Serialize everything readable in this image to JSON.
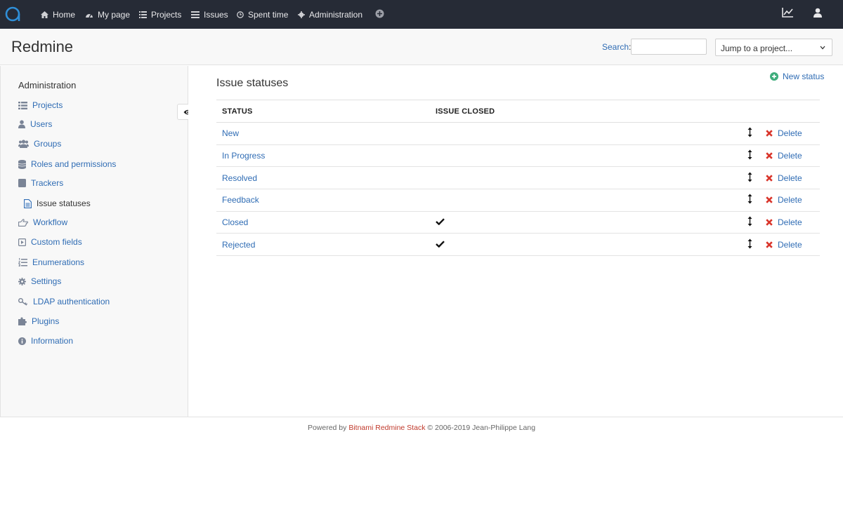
{
  "topnav": {
    "items": [
      {
        "label": "Home",
        "icon": "home-icon"
      },
      {
        "label": "My page",
        "icon": "dashboard-icon"
      },
      {
        "label": "Projects",
        "icon": "list-icon"
      },
      {
        "label": "Issues",
        "icon": "issues-icon"
      },
      {
        "label": "Spent time",
        "icon": "clock-icon"
      },
      {
        "label": "Administration",
        "icon": "gear-icon"
      }
    ],
    "right_icons": [
      "chart-icon",
      "user-icon"
    ],
    "accent": "#2f8fd8"
  },
  "header": {
    "title": "Redmine",
    "search_label": "Search",
    "search_colon": ":",
    "jump_label": "Jump to a project..."
  },
  "sidebar": {
    "title": "Administration",
    "items": [
      {
        "label": "Projects",
        "icon": "list-icon"
      },
      {
        "label": "Users",
        "icon": "user-icon"
      },
      {
        "label": "Groups",
        "icon": "group-icon"
      },
      {
        "label": "Roles and permissions",
        "icon": "database-icon"
      },
      {
        "label": "Trackers",
        "icon": "tracker-icon"
      },
      {
        "label": "Issue statuses",
        "icon": "document-icon",
        "selected": true
      },
      {
        "label": "Workflow",
        "icon": "hand-icon"
      },
      {
        "label": "Custom fields",
        "icon": "play-square-icon"
      },
      {
        "label": "Enumerations",
        "icon": "ordered-list-icon"
      },
      {
        "label": "Settings",
        "icon": "gear-icon"
      },
      {
        "label": "LDAP authentication",
        "icon": "key-icon"
      },
      {
        "label": "Plugins",
        "icon": "puzzle-icon"
      },
      {
        "label": "Information",
        "icon": "info-icon"
      }
    ]
  },
  "main": {
    "title": "Issue statuses",
    "new_status_label": "New status",
    "columns": [
      "Status",
      "Issue closed"
    ],
    "rows": [
      {
        "name": "New",
        "closed": false,
        "delete": "Delete"
      },
      {
        "name": "In Progress",
        "closed": false,
        "delete": "Delete"
      },
      {
        "name": "Resolved",
        "closed": false,
        "delete": "Delete"
      },
      {
        "name": "Feedback",
        "closed": false,
        "delete": "Delete"
      },
      {
        "name": "Closed",
        "closed": true,
        "delete": "Delete"
      },
      {
        "name": "Rejected",
        "closed": true,
        "delete": "Delete"
      }
    ]
  },
  "footer": {
    "prefix": "Powered by ",
    "brand": "Bitnami Redmine Stack",
    "suffix": " © 2006-2019 Jean-Philippe Lang"
  },
  "colors": {
    "link": "#2f6cb4",
    "topbar": "#262b36",
    "delete_icon": "#d9352b",
    "new_icon": "#3fad7c"
  }
}
